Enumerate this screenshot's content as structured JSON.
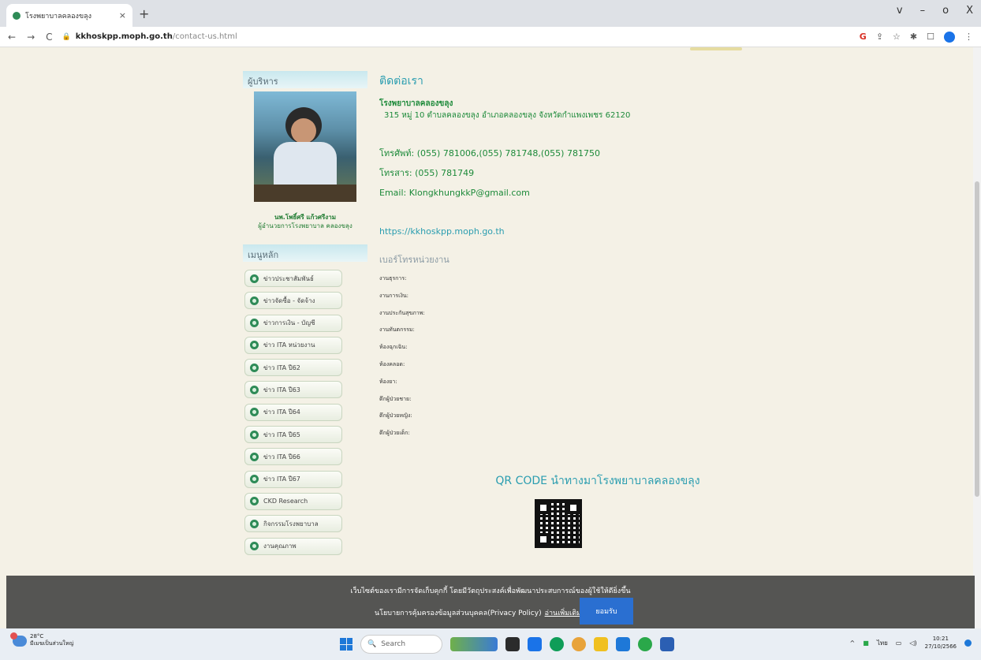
{
  "browser": {
    "tab_title": "โรงพยาบาลคลองขลุง",
    "tab_close": "×",
    "new_tab": "+",
    "url_host": "kkhoskpp.moph.go.th",
    "url_path": "/contact-us.html",
    "nav_back": "←",
    "nav_forward": "→",
    "nav_reload": "C",
    "win_controls": [
      "v",
      "–",
      "o",
      "X"
    ],
    "ext_icons": [
      "G",
      "☆",
      "✱",
      "☐"
    ]
  },
  "sidebar": {
    "executive_heading": "ผู้บริหาร",
    "executive_name": "นพ.โพธิ์ศรี แก้วศรีงาม",
    "executive_position": "ผู้อำนวยการโรงพยาบาล คลองขลุง",
    "menu_heading": "เมนูหลัก",
    "menu_items": [
      "ข่าวประชาสัมพันธ์",
      "ข่าวจัดซื้อ - จัดจ้าง",
      "ข่าวการเงิน - บัญชี",
      "ข่าว ITA หน่วยงาน",
      "ข่าว ITA ปี62",
      "ข่าว ITA ปี63",
      "ข่าว ITA ปี64",
      "ข่าว ITA ปี65",
      "ข่าว ITA ปี66",
      "ข่าว ITA ปี67",
      "CKD Research",
      "กิจกรรมโรงพยาบาล",
      "งานคุณภาพ"
    ]
  },
  "main": {
    "heading": "ติดต่อเรา",
    "org_name": "โรงพยาบาลคลองขลุง",
    "address": "315 หมู่ 10 ตำบลคลองขลุง อำเภอคลองขลุง จังหวัดกำแพงเพชร 62120",
    "phone": "โทรศัพท์: (055) 781006,(055) 781748,(055) 781750",
    "fax": "โทรสาร: (055) 781749",
    "email": "Email: KlongkhungkkP@gmail.com",
    "website": "https://kkhoskpp.moph.go.th",
    "dept_heading": "เบอร์โทรหน่วยงาน",
    "departments": [
      "งานธุรการ:",
      "งานการเงิน:",
      "งานประกันสุขภาพ:",
      "งานทันตกรรม:",
      "ห้องฉุกเฉิน:",
      "ห้องคลอด:",
      "ห้องยา:",
      "ตึกผู้ป่วยชาย:",
      "ตึกผู้ป่วยหญิง:",
      "ตึกผู้ป่วยเด็ก:"
    ],
    "qr_title": "QR CODE นำทางมาโรงพยาบาลคลองขลุง"
  },
  "cookie": {
    "line1": "เว็บไซต์ของเรามีการจัดเก็บคุกกี้ โดยมีวัตถุประสงค์เพื่อพัฒนาประสบการณ์ของผู้ใช้ให้ดียิ่งขึ้น",
    "line2": "นโยบายการคุ้มครองข้อมูลส่วนบุคคล(Privacy Policy)",
    "more_link": "อ่านเพิ่มเติม",
    "accept": "ยอมรับ"
  },
  "taskbar": {
    "weather_temp": "28°C",
    "weather_text": "มีเมฆเป็นส่วนใหญ่",
    "search": "Search",
    "time": "10:21",
    "date": "27/10/2566"
  }
}
